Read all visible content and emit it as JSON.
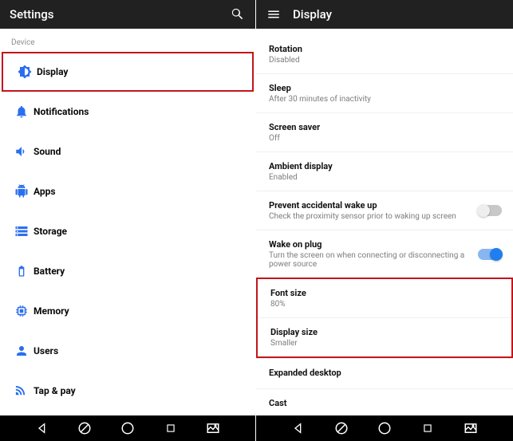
{
  "left": {
    "app_bar": {
      "title": "Settings"
    },
    "section": "Device",
    "items": [
      {
        "icon": "brightness-icon",
        "label": "Display",
        "highlight": true
      },
      {
        "icon": "bell-icon",
        "label": "Notifications"
      },
      {
        "icon": "volume-icon",
        "label": "Sound"
      },
      {
        "icon": "android-icon",
        "label": "Apps"
      },
      {
        "icon": "storage-icon",
        "label": "Storage"
      },
      {
        "icon": "battery-icon",
        "label": "Battery"
      },
      {
        "icon": "memory-icon",
        "label": "Memory"
      },
      {
        "icon": "users-icon",
        "label": "Users"
      },
      {
        "icon": "tap-pay-icon",
        "label": "Tap & pay"
      }
    ]
  },
  "right": {
    "app_bar": {
      "title": "Display"
    },
    "items": [
      {
        "title": "Rotation",
        "sub": "Disabled"
      },
      {
        "title": "Sleep",
        "sub": "After 30 minutes of inactivity"
      },
      {
        "title": "Screen saver",
        "sub": "Off"
      },
      {
        "title": "Ambient display",
        "sub": "Enabled"
      },
      {
        "title": "Prevent accidental wake up",
        "sub": "Check the proximity sensor prior to waking up screen",
        "toggle": "off"
      },
      {
        "title": "Wake on plug",
        "sub": "Turn the screen on when connecting or disconnecting a power source",
        "toggle": "on"
      },
      {
        "title": "Font size",
        "sub": "80%",
        "highlight": true
      },
      {
        "title": "Display size",
        "sub": "Smaller",
        "highlight": true
      },
      {
        "title": "Expanded desktop"
      },
      {
        "title": "Cast"
      }
    ]
  },
  "colors": {
    "accent": "#2a6ff0"
  }
}
